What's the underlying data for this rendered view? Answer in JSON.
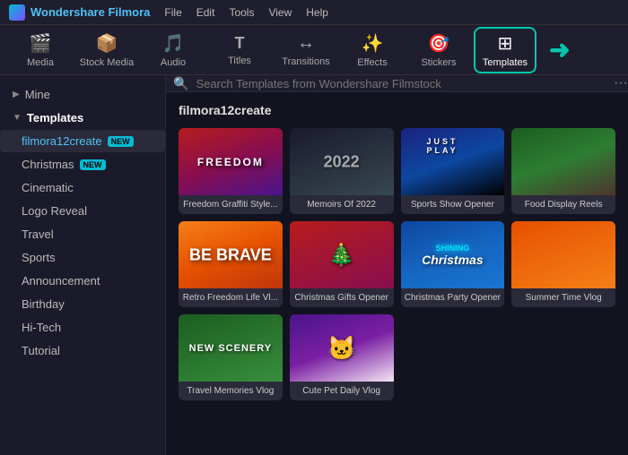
{
  "app": {
    "title": "Wondershare Filmora",
    "logo_text": "Wondershare Filmora"
  },
  "menu": {
    "items": [
      "File",
      "Edit",
      "Tools",
      "View",
      "Help"
    ]
  },
  "toolbar": {
    "buttons": [
      {
        "id": "media",
        "label": "Media",
        "icon": "🎬"
      },
      {
        "id": "stock",
        "label": "Stock Media",
        "icon": "📦"
      },
      {
        "id": "audio",
        "label": "Audio",
        "icon": "🎵"
      },
      {
        "id": "titles",
        "label": "Titles",
        "icon": "T"
      },
      {
        "id": "transitions",
        "label": "Transitions",
        "icon": "↔"
      },
      {
        "id": "effects",
        "label": "Effects",
        "icon": "✨"
      },
      {
        "id": "stickers",
        "label": "Stickers",
        "icon": "🎯"
      },
      {
        "id": "templates",
        "label": "Templates",
        "icon": "⊞"
      }
    ]
  },
  "sidebar": {
    "mine_label": "Mine",
    "templates_label": "Templates",
    "categories": [
      {
        "id": "filmora12create",
        "label": "filmora12create",
        "badge": "NEW",
        "active": true
      },
      {
        "id": "christmas",
        "label": "Christmas",
        "badge": "NEW"
      },
      {
        "id": "cinematic",
        "label": "Cinematic"
      },
      {
        "id": "logo-reveal",
        "label": "Logo Reveal"
      },
      {
        "id": "travel",
        "label": "Travel"
      },
      {
        "id": "sports",
        "label": "Sports"
      },
      {
        "id": "announcement",
        "label": "Announcement"
      },
      {
        "id": "birthday",
        "label": "Birthday"
      },
      {
        "id": "hi-tech",
        "label": "Hi-Tech"
      },
      {
        "id": "tutorial",
        "label": "Tutorial"
      }
    ]
  },
  "search": {
    "placeholder": "Search Templates from Wondershare Filmstock"
  },
  "content": {
    "section_title": "filmora12create",
    "templates": [
      {
        "id": "freedom-graffiti",
        "label": "Freedom Graffiti Style...",
        "card_class": "card-freedom",
        "overlay_text": "FREEDOM",
        "overlay_sub": ""
      },
      {
        "id": "memoirs-2022",
        "label": "Memoirs Of 2022",
        "card_class": "card-memoirs",
        "overlay_text": "2022",
        "overlay_sub": ""
      },
      {
        "id": "sports-show-opener",
        "label": "Sports Show Opener",
        "card_class": "card-sports",
        "overlay_text": "JUST PLAY",
        "overlay_sub": ""
      },
      {
        "id": "food-display-reels",
        "label": "Food Display Reels",
        "card_class": "card-food",
        "overlay_text": "",
        "overlay_sub": ""
      },
      {
        "id": "retro-freedom",
        "label": "Retro Freedom Life Vl...",
        "card_class": "card-retro",
        "overlay_text": "BE BRAVE",
        "overlay_sub": ""
      },
      {
        "id": "christmas-gifts",
        "label": "Christmas Gifts Opener",
        "card_class": "card-xmas",
        "overlay_text": "🎄",
        "overlay_sub": ""
      },
      {
        "id": "christmas-party",
        "label": "Christmas Party Opener",
        "card_class": "card-xmasparty",
        "overlay_text": "SHINING\nChristmas",
        "overlay_sub": ""
      },
      {
        "id": "summer-time-vlog",
        "label": "Summer Time Vlog",
        "card_class": "card-summer",
        "overlay_text": "",
        "overlay_sub": ""
      },
      {
        "id": "travel-memories",
        "label": "Travel Memories Vlog",
        "card_class": "card-travel",
        "overlay_text": "NEW SCENERY",
        "overlay_sub": ""
      },
      {
        "id": "cute-pet",
        "label": "Cute Pet Daily Vlog",
        "card_class": "card-pet",
        "overlay_text": "",
        "overlay_sub": ""
      }
    ]
  }
}
